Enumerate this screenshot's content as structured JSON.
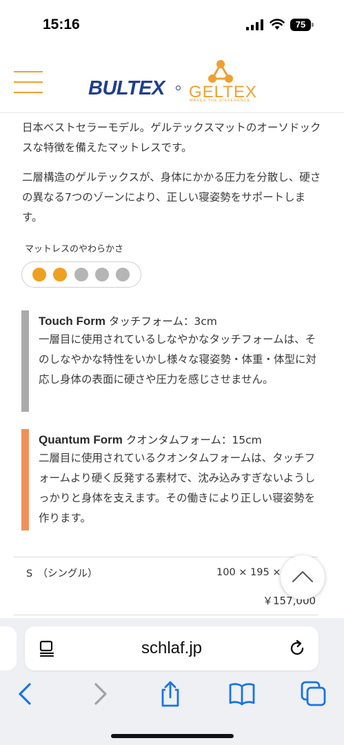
{
  "status_bar": {
    "time": "15:16",
    "battery": "75"
  },
  "header": {
    "brand_primary": "BULTEX",
    "brand_secondary": "GELTEX",
    "brand_secondary_tagline": "MAKES THE DIFFERENCE"
  },
  "content": {
    "intro": "日本ベストセラーモデル。ゲルテックスマットのオーソドックスな特徴を備えたマットレスです。",
    "description": "二層構造のゲルテックスが、身体にかかる圧力を分散し、硬さの異なる7つのゾーンにより、正しい寝姿勢をサポートします。",
    "softness": {
      "label": "マットレスのやわらかさ",
      "rating": 2,
      "max": 5
    },
    "layers": [
      {
        "name": "Touch Form",
        "spec": "タッチフォーム：3cm",
        "description": "一層目に使用されているしなやかなタッチフォームは、そのしなやかな特性をいかし様々な寝姿勢・体重・体型に対応し身体の表面に硬さや圧力を感じさせません。",
        "color": "#aaaaaa"
      },
      {
        "name": "Quantum Form",
        "spec": "クオンタムフォーム：15cm",
        "description": "二層目に使用されているクオンタムフォームは、タッチフォームより硬く反発する素材で、沈み込みすぎないようしっかりと身体を支えます。その働きにより正しい寝姿勢を作ります。",
        "color": "#f0905a"
      }
    ],
    "size_row": {
      "size": "S　（シングル）",
      "dimensions": "100 × 195 ×",
      "price": "￥157,000"
    }
  },
  "browser": {
    "url": "schlaf.jp"
  },
  "colors": {
    "accent": "#f0a020",
    "brand_blue": "#1f3f8f",
    "ios_blue": "#1a73e8"
  }
}
